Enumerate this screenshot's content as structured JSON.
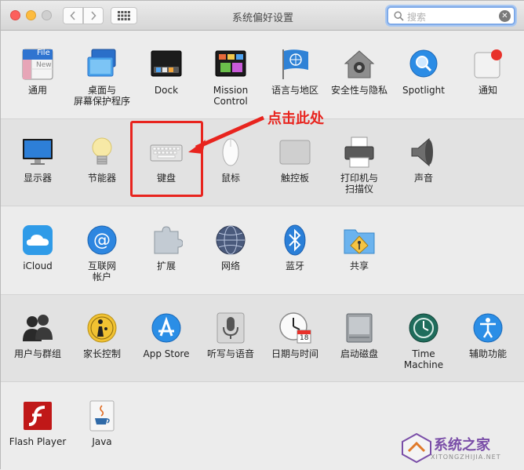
{
  "window": {
    "title": "系统偏好设置"
  },
  "search": {
    "placeholder": "搜索"
  },
  "rows": [
    [
      {
        "name": "general",
        "label": [
          "通用"
        ]
      },
      {
        "name": "desktop",
        "label": [
          "桌面与",
          "屏幕保护程序"
        ]
      },
      {
        "name": "dock",
        "label": [
          "Dock"
        ]
      },
      {
        "name": "mission-control",
        "label": [
          "Mission",
          "Control"
        ]
      },
      {
        "name": "language-region",
        "label": [
          "语言与地区"
        ]
      },
      {
        "name": "security-privacy",
        "label": [
          "安全性与隐私"
        ]
      },
      {
        "name": "spotlight",
        "label": [
          "Spotlight"
        ]
      },
      {
        "name": "notifications",
        "label": [
          "通知"
        ]
      }
    ],
    [
      {
        "name": "displays",
        "label": [
          "显示器"
        ]
      },
      {
        "name": "energy-saver",
        "label": [
          "节能器"
        ]
      },
      {
        "name": "keyboard",
        "label": [
          "键盘"
        ]
      },
      {
        "name": "mouse",
        "label": [
          "鼠标"
        ]
      },
      {
        "name": "trackpad",
        "label": [
          "触控板"
        ]
      },
      {
        "name": "printers-scanners",
        "label": [
          "打印机与",
          "扫描仪"
        ]
      },
      {
        "name": "sound",
        "label": [
          "声音"
        ]
      }
    ],
    [
      {
        "name": "icloud",
        "label": [
          "iCloud"
        ]
      },
      {
        "name": "internet-accounts",
        "label": [
          "互联网",
          "帐户"
        ]
      },
      {
        "name": "extensions",
        "label": [
          "扩展"
        ]
      },
      {
        "name": "network",
        "label": [
          "网络"
        ]
      },
      {
        "name": "bluetooth",
        "label": [
          "蓝牙"
        ]
      },
      {
        "name": "sharing",
        "label": [
          "共享"
        ]
      }
    ],
    [
      {
        "name": "users-groups",
        "label": [
          "用户与群组"
        ]
      },
      {
        "name": "parental-controls",
        "label": [
          "家长控制"
        ]
      },
      {
        "name": "app-store",
        "label": [
          "App Store"
        ]
      },
      {
        "name": "dictation-speech",
        "label": [
          "听写与语音"
        ]
      },
      {
        "name": "date-time",
        "label": [
          "日期与时间"
        ]
      },
      {
        "name": "startup-disk",
        "label": [
          "启动磁盘"
        ]
      },
      {
        "name": "time-machine",
        "label": [
          "Time Machine"
        ]
      },
      {
        "name": "accessibility",
        "label": [
          "辅助功能"
        ]
      }
    ],
    [
      {
        "name": "flash-player",
        "label": [
          "Flash Player"
        ]
      },
      {
        "name": "java",
        "label": [
          "Java"
        ]
      }
    ]
  ],
  "annotation": {
    "text": "点击此处"
  },
  "watermark": {
    "text": "系统之家",
    "url": "XITONGZHIJIA.NET"
  },
  "icons": {
    "general_file_text": "File",
    "general_new_text": "New",
    "date_time_day": "18"
  }
}
